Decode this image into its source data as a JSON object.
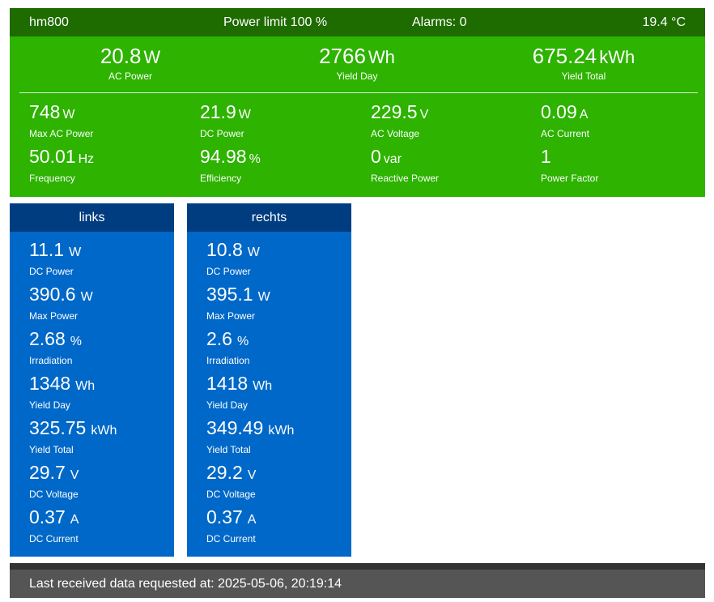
{
  "inverter": {
    "name": "hm800",
    "power_limit": "Power limit 100 %",
    "alarms": "Alarms: 0",
    "temperature": "19.4 °C",
    "big": [
      {
        "value": "20.8",
        "unit": "W",
        "label": "AC Power"
      },
      {
        "value": "2766",
        "unit": "Wh",
        "label": "Yield Day"
      },
      {
        "value": "675.24",
        "unit": "kWh",
        "label": "Yield Total"
      }
    ],
    "small": [
      {
        "value": "748",
        "unit": "W",
        "label": "Max AC Power"
      },
      {
        "value": "21.9",
        "unit": "W",
        "label": "DC Power"
      },
      {
        "value": "229.5",
        "unit": "V",
        "label": "AC Voltage"
      },
      {
        "value": "0.09",
        "unit": "A",
        "label": "AC Current"
      },
      {
        "value": "50.01",
        "unit": "Hz",
        "label": "Frequency"
      },
      {
        "value": "94.98",
        "unit": "%",
        "label": "Efficiency"
      },
      {
        "value": "0",
        "unit": "var",
        "label": "Reactive Power"
      },
      {
        "value": "1",
        "unit": "",
        "label": "Power Factor"
      }
    ]
  },
  "strings": [
    {
      "name": "links",
      "fields": [
        {
          "value": "11.1",
          "unit": "W",
          "label": "DC Power"
        },
        {
          "value": "390.6",
          "unit": "W",
          "label": "Max Power"
        },
        {
          "value": "2.68",
          "unit": "%",
          "label": "Irradiation"
        },
        {
          "value": "1348",
          "unit": "Wh",
          "label": "Yield Day"
        },
        {
          "value": "325.75",
          "unit": "kWh",
          "label": "Yield Total"
        },
        {
          "value": "29.7",
          "unit": "V",
          "label": "DC Voltage"
        },
        {
          "value": "0.37",
          "unit": "A",
          "label": "DC Current"
        }
      ]
    },
    {
      "name": "rechts",
      "fields": [
        {
          "value": "10.8",
          "unit": "W",
          "label": "DC Power"
        },
        {
          "value": "395.1",
          "unit": "W",
          "label": "Max Power"
        },
        {
          "value": "2.6",
          "unit": "%",
          "label": "Irradiation"
        },
        {
          "value": "1418",
          "unit": "Wh",
          "label": "Yield Day"
        },
        {
          "value": "349.49",
          "unit": "kWh",
          "label": "Yield Total"
        },
        {
          "value": "29.2",
          "unit": "V",
          "label": "DC Voltage"
        },
        {
          "value": "0.37",
          "unit": "A",
          "label": "DC Current"
        }
      ]
    }
  ],
  "footer": {
    "text": "Last received data requested at: 2025-05-06, 20:19:14"
  },
  "colors": {
    "inverter_bg": "#2db300",
    "inverter_header": "#1e6b00",
    "string_bg": "#0068c8",
    "string_header": "#003d80",
    "footer_bg": "#555555"
  }
}
